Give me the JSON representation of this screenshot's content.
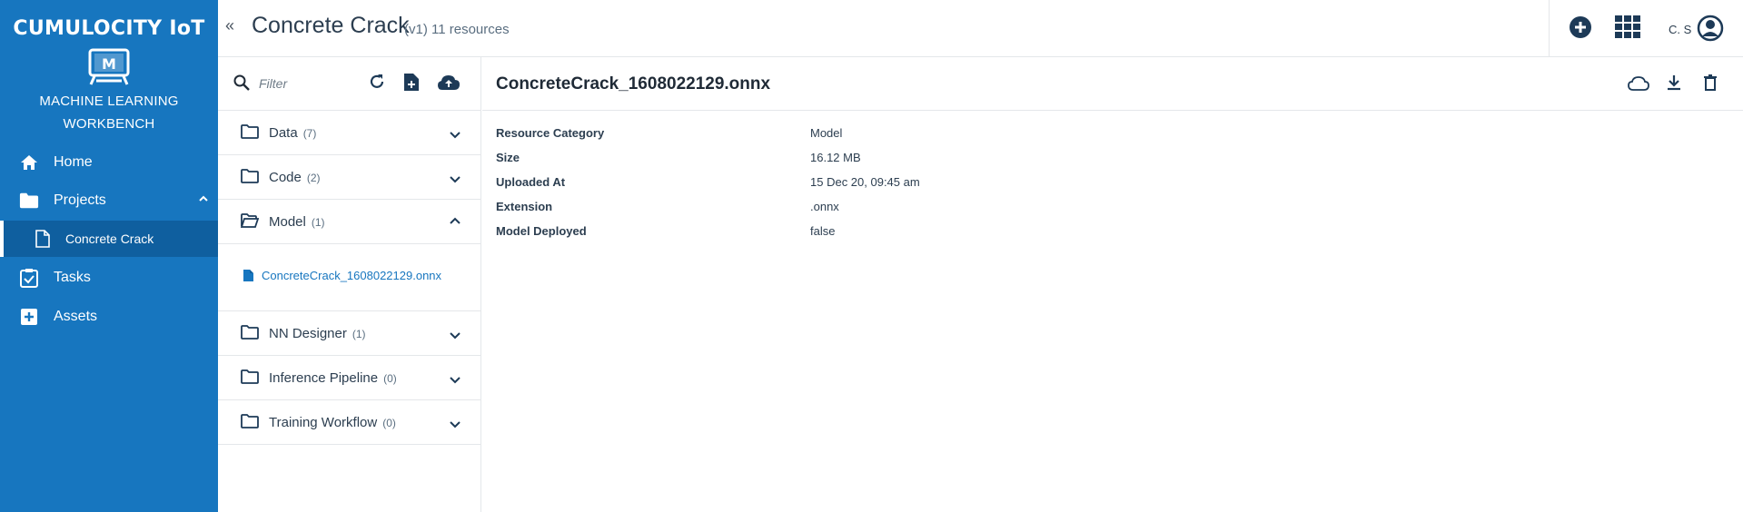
{
  "brand": {
    "name": "CUMULOCITY IoT",
    "app_name_line1": "MACHINE LEARNING",
    "app_name_line2": "WORKBENCH"
  },
  "nav": {
    "items": [
      {
        "label": "Home",
        "icon": "home-icon"
      },
      {
        "label": "Projects",
        "icon": "folder-icon",
        "expanded": true
      },
      {
        "label": "Concrete Crack",
        "icon": "file-icon",
        "active": true
      },
      {
        "label": "Tasks",
        "icon": "clipboard-check-icon"
      },
      {
        "label": "Assets",
        "icon": "add-box-icon"
      }
    ]
  },
  "header": {
    "collapse_glyph": "«",
    "title": "Concrete Crack",
    "subtitle": "(v1) 11 resources",
    "user_initials": "C. S"
  },
  "panel": {
    "filter_placeholder": "Filter",
    "groups": [
      {
        "label": "Data",
        "count": "(7)",
        "open": false
      },
      {
        "label": "Code",
        "count": "(2)",
        "open": false
      },
      {
        "label": "Model",
        "count": "(1)",
        "open": true
      },
      {
        "label": "NN Designer",
        "count": "(1)",
        "open": false
      },
      {
        "label": "Inference Pipeline",
        "count": "(0)",
        "open": false
      },
      {
        "label": "Training Workflow",
        "count": "(0)",
        "open": false
      }
    ],
    "model_file": "ConcreteCrack_1608022129.onnx"
  },
  "details": {
    "title": "ConcreteCrack_1608022129.onnx",
    "properties": [
      {
        "key": "Resource Category",
        "value": "Model"
      },
      {
        "key": "Size",
        "value": "16.12 MB"
      },
      {
        "key": "Uploaded At",
        "value": "15 Dec 20, 09:45 am"
      },
      {
        "key": "Extension",
        "value": ".onnx"
      },
      {
        "key": "Model Deployed",
        "value": "false"
      }
    ]
  },
  "colors": {
    "brand_blue": "#1776bf",
    "active_sub": "#0f5f9f",
    "icon_dark": "#1d3a57",
    "link": "#1776bf"
  }
}
